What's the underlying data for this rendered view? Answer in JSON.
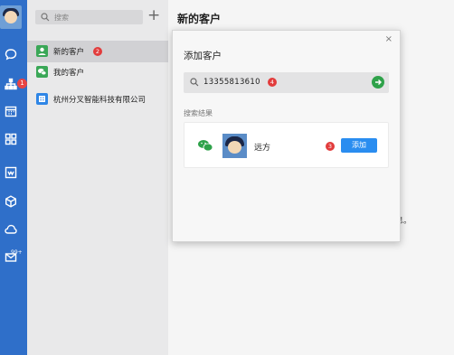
{
  "rail": {
    "badge_count": "1",
    "mail_badge": "99+",
    "icons": [
      "avatar",
      "chat-icon",
      "org-icon",
      "calendar-icon",
      "apps-icon",
      "doc-icon",
      "cube-icon",
      "cloud-icon",
      "mail-icon"
    ]
  },
  "sidebar": {
    "search_placeholder": "搜索",
    "add_label": "+",
    "items": [
      {
        "label": "新的客户",
        "step": "2",
        "icon": "contact-add-icon",
        "color": "#3aa757"
      },
      {
        "label": "我的客户",
        "icon": "wechat-icon",
        "color": "#3aa757"
      },
      {
        "label": "杭州分叉智能科技有限公司",
        "icon": "company-icon",
        "color": "#2f86e6"
      }
    ]
  },
  "main": {
    "title": "新的客户",
    "hint_fragment": "息。"
  },
  "dialog": {
    "title": "添加客户",
    "close_label": "×",
    "search_value": "13355813610",
    "search_step": "4",
    "results_label": "搜索结果",
    "result": {
      "name": "远方",
      "add_label": "添加",
      "step": "3"
    }
  },
  "colors": {
    "rail": "#2f6fc9",
    "accent_green": "#2fa24a",
    "primary_button": "#2a8df0",
    "step_badge": "#e23c3c"
  }
}
